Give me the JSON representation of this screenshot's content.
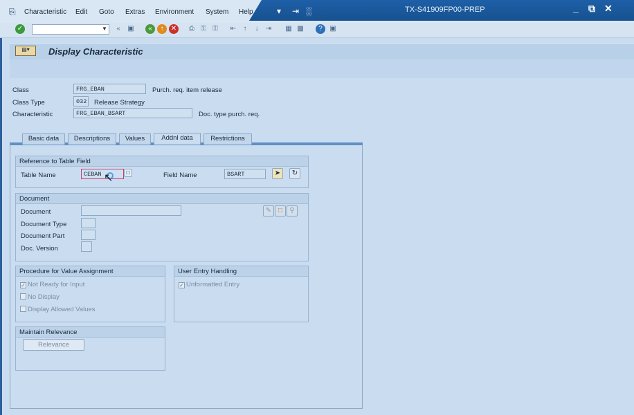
{
  "menu": {
    "items": [
      "Characteristic",
      "Edit",
      "Goto",
      "Extras",
      "Environment",
      "System",
      "Help"
    ]
  },
  "window": {
    "title": "TX-S41909FP00-PREP",
    "controls": {
      "minimize": "_",
      "restore": "⧉",
      "close": "✕"
    }
  },
  "toolbar": {
    "command_value": "",
    "nav_back": "«"
  },
  "page": {
    "title": "Display Characteristic"
  },
  "header_fields": {
    "class_label": "Class",
    "class_value": "FRG_EBAN",
    "class_desc": "Purch. req. item release",
    "class_type_label": "Class Type",
    "class_type_value": "032",
    "class_type_desc": "Release Strategy",
    "characteristic_label": "Characteristic",
    "characteristic_value": "FRG_EBAN_BSART",
    "characteristic_desc": "Doc. type purch. req."
  },
  "tabs": [
    {
      "label": "Basic data",
      "active": false
    },
    {
      "label": "Descriptions",
      "active": false
    },
    {
      "label": "Values",
      "active": false
    },
    {
      "label": "Addnl data",
      "active": true
    },
    {
      "label": "Restrictions",
      "active": false
    }
  ],
  "reference": {
    "title": "Reference to Table Field",
    "table_label": "Table Name",
    "table_value": "CEBAN",
    "field_label": "Field Name",
    "field_value": "BSART"
  },
  "document": {
    "title": "Document",
    "document_label": "Document",
    "document_value": "",
    "type_label": "Document Type",
    "part_label": "Document Part",
    "version_label": "Doc. Version"
  },
  "procedure": {
    "title": "Procedure for Value Assignment",
    "options": [
      {
        "label": "Not Ready for Input",
        "checked": true
      },
      {
        "label": "No Display",
        "checked": false
      },
      {
        "label": "Display Allowed Values",
        "checked": false
      }
    ]
  },
  "user_entry": {
    "title": "User Entry Handling",
    "option_label": "Unformatted Entry",
    "checked": true
  },
  "relevance": {
    "title": "Maintain Relevance",
    "button_label": "Relevance"
  },
  "colors": {
    "background": "#c9dcf0",
    "title_blue": "#1e5fa8",
    "ok_green": "#3c9a3c"
  }
}
